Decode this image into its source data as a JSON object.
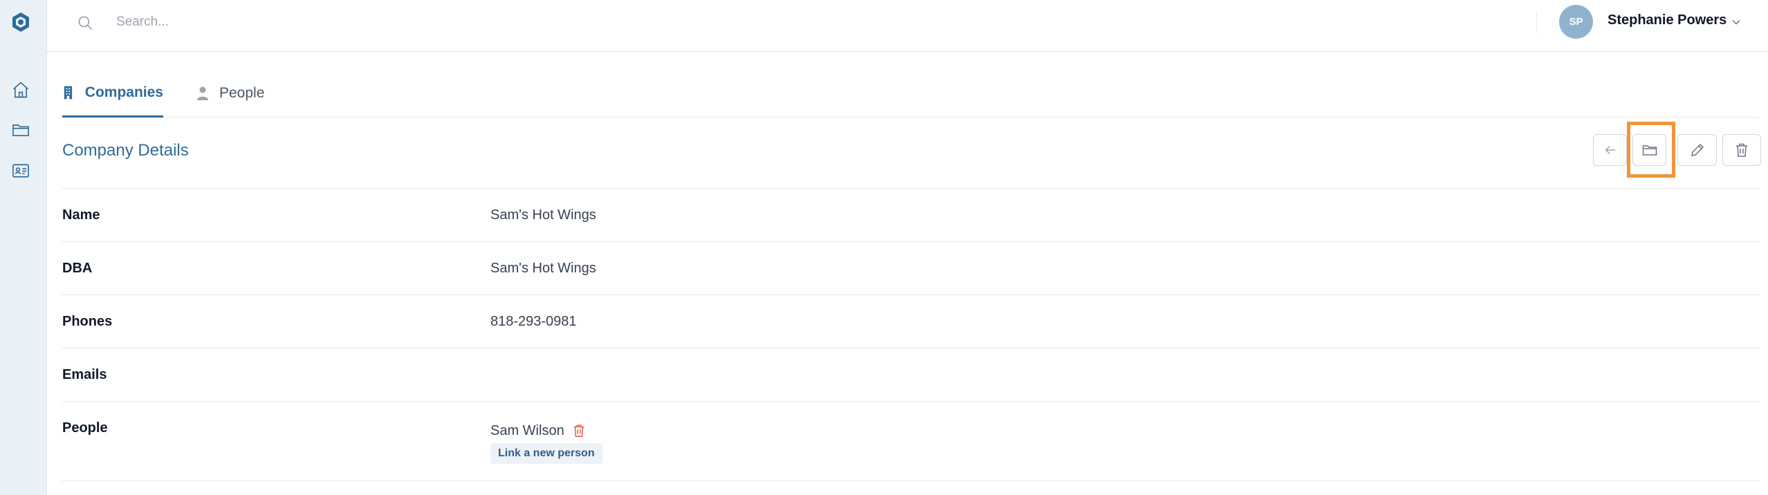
{
  "colors": {
    "accent": "#2f6b9a",
    "sidebar_bg": "#eaf1f6",
    "avatar_bg": "#8fb3cf",
    "danger": "#e4573d",
    "highlight": "#f0953a"
  },
  "sidebar": {
    "logo": "app-logo-icon",
    "items": [
      {
        "icon": "home-icon"
      },
      {
        "icon": "folder-icon"
      },
      {
        "icon": "contact-card-icon"
      }
    ]
  },
  "header": {
    "search": {
      "placeholder": "Search...",
      "value": ""
    },
    "user": {
      "initials": "SP",
      "name": "Stephanie Powers"
    }
  },
  "tabs": [
    {
      "label": "Companies",
      "icon": "building-icon",
      "active": true
    },
    {
      "label": "People",
      "icon": "person-icon",
      "active": false
    }
  ],
  "details": {
    "title": "Company Details",
    "actions": [
      "back-arrow-icon",
      "folder-icon",
      "pencil-icon",
      "trash-icon"
    ],
    "fields": {
      "name": {
        "label": "Name",
        "value": "Sam's Hot Wings"
      },
      "dba": {
        "label": "DBA",
        "value": "Sam's Hot Wings"
      },
      "phones": {
        "label": "Phones",
        "value": "818-293-0981"
      },
      "emails": {
        "label": "Emails",
        "value": ""
      },
      "people": {
        "label": "People",
        "items": [
          "Sam Wilson"
        ],
        "link_label": "Link a new person"
      }
    }
  }
}
